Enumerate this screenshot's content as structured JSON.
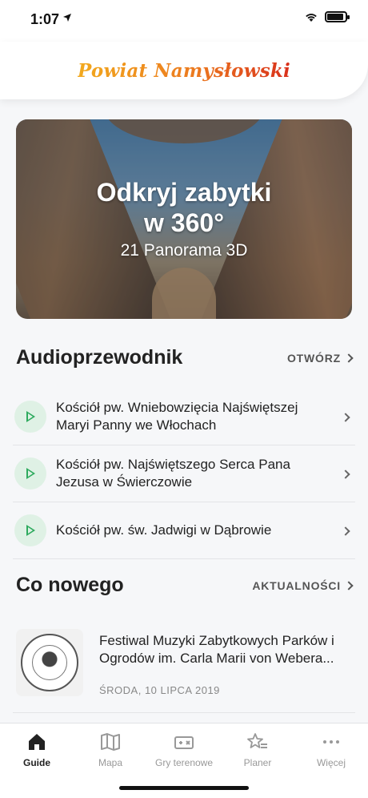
{
  "status_bar": {
    "time": "1:07",
    "location_icon": "location-arrow-icon",
    "wifi_icon": "wifi-icon",
    "battery_icon": "battery-icon"
  },
  "header": {
    "brand": "Powiat Namysłowski"
  },
  "banner": {
    "title_line1": "Odkryj zabytki",
    "title_line2": "w 360°",
    "subtitle": "21 Panorama 3D"
  },
  "audio": {
    "title": "Audioprzewodnik",
    "link": "OTWÓRZ",
    "items": [
      {
        "label": "Kościół pw. Wniebowzięcia Najświętszej Maryi Panny we Włochach"
      },
      {
        "label": "Kościół pw. Najświętszego Serca Pana Jezusa w Świerczowie"
      },
      {
        "label": "Kościół pw. św. Jadwigi w Dąbrowie"
      }
    ]
  },
  "news": {
    "title": "Co nowego",
    "link": "AKTUALNOŚCI",
    "items": [
      {
        "title": "Festiwal Muzyki Zabytkowych Parków i Ogrodów im. Carla Marii von Webera...",
        "date": "ŚRODA, 10 LIPCA 2019"
      }
    ]
  },
  "tabs": [
    {
      "label": "Guide",
      "icon": "home-icon",
      "active": true
    },
    {
      "label": "Mapa",
      "icon": "map-icon",
      "active": false
    },
    {
      "label": "Gry terenowe",
      "icon": "game-icon",
      "active": false
    },
    {
      "label": "Planer",
      "icon": "star-list-icon",
      "active": false
    },
    {
      "label": "Więcej",
      "icon": "more-icon",
      "active": false
    }
  ],
  "colors": {
    "accent_green": "#2eaa5e",
    "brand_orange": "#ec7a1f",
    "brand_red": "#d9301c"
  }
}
